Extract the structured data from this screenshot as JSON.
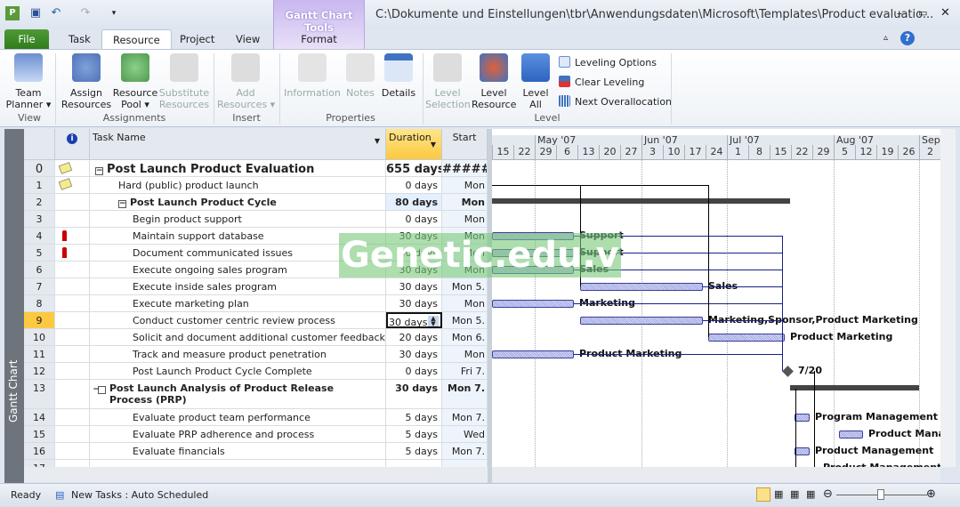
{
  "window": {
    "title": "C:\\Dokumente und Einstellungen\\tbr\\Anwendungsdaten\\Microsoft\\Templates\\Product evaluatio...",
    "context_group": "Gantt Chart Tools",
    "context_tab": "Format"
  },
  "tabs": [
    "File",
    "Task",
    "Resource",
    "Project",
    "View"
  ],
  "active_tab": "Resource",
  "ribbon": {
    "view": {
      "label": "View",
      "team_planner": "Team\nPlanner ▾"
    },
    "assignments": {
      "label": "Assignments",
      "assign": "Assign\nResources",
      "pool": "Resource\nPool ▾",
      "substitute": "Substitute\nResources"
    },
    "insert": {
      "label": "Insert",
      "add": "Add\nResources ▾"
    },
    "properties": {
      "label": "Properties",
      "information": "Information",
      "notes": "Notes",
      "details": "Details"
    },
    "level": {
      "label": "Level",
      "selection": "Level\nSelection",
      "resource": "Level\nResource",
      "all": "Level\nAll",
      "options": "Leveling Options",
      "clear": "Clear Leveling",
      "next": "Next Overallocation"
    }
  },
  "side_label": "Gantt Chart",
  "columns": {
    "info": "i",
    "name": "Task Name",
    "duration": "Duration",
    "start": "Start"
  },
  "rows": [
    {
      "id": "0",
      "name": "Post Launch Product Evaluation",
      "duration": "655 days",
      "start": "#######",
      "level": 0,
      "summary": true,
      "indicator": "note"
    },
    {
      "id": "1",
      "name": "Hard (public) product launch",
      "duration": "0 days",
      "start": "Mon",
      "level": 1,
      "indicator": "note"
    },
    {
      "id": "2",
      "name": "Post Launch Product Cycle",
      "duration": "80 days",
      "start": "Mon",
      "level": 1,
      "summary": true
    },
    {
      "id": "3",
      "name": "Begin product support",
      "duration": "0 days",
      "start": "Mon",
      "level": 2
    },
    {
      "id": "4",
      "name": "Maintain support database",
      "duration": "30 days",
      "start": "Mon",
      "level": 2,
      "indicator": "overallocated"
    },
    {
      "id": "5",
      "name": "Document communicated issues",
      "duration": "30 days",
      "start": "Mon",
      "level": 2,
      "indicator": "overallocated"
    },
    {
      "id": "6",
      "name": "Execute ongoing sales program",
      "duration": "30 days",
      "start": "Mon",
      "level": 2
    },
    {
      "id": "7",
      "name": "Execute inside sales program",
      "duration": "30 days",
      "start": "Mon 5.",
      "level": 2
    },
    {
      "id": "8",
      "name": "Execute marketing plan",
      "duration": "30 days",
      "start": "Mon",
      "level": 2
    },
    {
      "id": "9",
      "name": "Conduct customer centric review process",
      "duration": "30 days",
      "start": "Mon 5.",
      "level": 2,
      "selected": true
    },
    {
      "id": "10",
      "name": "Solicit and document additional customer feedback",
      "duration": "20 days",
      "start": "Mon 6.",
      "level": 2
    },
    {
      "id": "11",
      "name": "Track and measure product penetration",
      "duration": "30 days",
      "start": "Mon",
      "level": 2
    },
    {
      "id": "12",
      "name": "Post Launch Product Cycle Complete",
      "duration": "0 days",
      "start": "Fri 7.",
      "level": 2
    },
    {
      "id": "13",
      "name": "Post Launch Analysis of Product Release Process (PRP)",
      "duration": "30 days",
      "start": "Mon 7.",
      "level": 1,
      "summary": true
    },
    {
      "id": "14",
      "name": "Evaluate product team performance",
      "duration": "5 days",
      "start": "Mon 7.",
      "level": 2
    },
    {
      "id": "15",
      "name": "Evaluate PRP adherence and process",
      "duration": "5 days",
      "start": "Wed",
      "level": 2
    },
    {
      "id": "16",
      "name": "Evaluate financials",
      "duration": "5 days",
      "start": "Mon 7.",
      "level": 2
    },
    {
      "id": "17",
      "name": "",
      "duration": "",
      "start": "",
      "level": 2
    }
  ],
  "timescale": {
    "months": [
      "May '07",
      "Jun '07",
      "Jul '07",
      "Aug '07",
      "Sep '07"
    ],
    "weeks": [
      "15",
      "22",
      "29",
      "6",
      "13",
      "20",
      "27",
      "3",
      "10",
      "17",
      "24",
      "1",
      "8",
      "15",
      "22",
      "29",
      "5",
      "12",
      "19",
      "26",
      "2"
    ]
  },
  "bar_labels": {
    "r4": "Support",
    "r5": "Support",
    "r6": "Sales",
    "r7": "Sales",
    "r8": "Marketing",
    "r9": "Marketing,Sponsor,Product Marketing",
    "r10": "Product Marketing",
    "r11": "Product Marketing",
    "r12": "7/20",
    "r14": "Program Management",
    "r15": "Product Manag",
    "r16": "Product Management",
    "r17": "Product Management"
  },
  "watermark": "Genetic.edu.vn",
  "status": {
    "ready": "Ready",
    "new_tasks": "New Tasks : Auto Scheduled"
  }
}
